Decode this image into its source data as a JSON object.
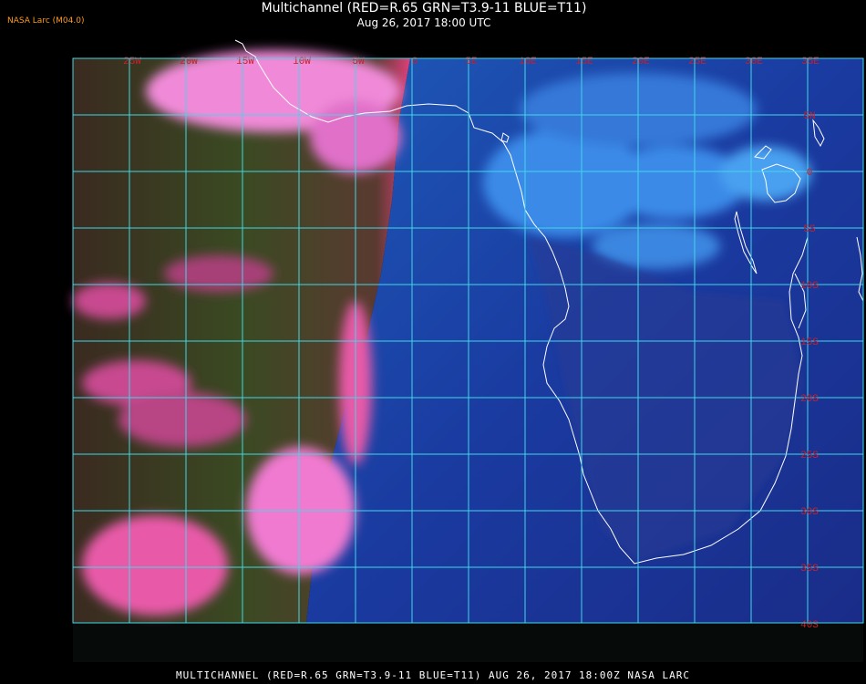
{
  "header": {
    "brand": "NASA Larc (M04.0)",
    "title": "Multichannel (RED=R.65 GRN=T3.9-11 BLUE=T11)",
    "subtitle": "Aug 26, 2017 18:00 UTC"
  },
  "footer": {
    "caption": "MULTICHANNEL (RED=R.65 GRN=T3.9-11 BLUE=T11) AUG 26, 2017 18:00Z   NASA LARC"
  },
  "map": {
    "longitude_labels": [
      "25W",
      "20W",
      "15W",
      "10W",
      "5W",
      "0",
      "5E",
      "10E",
      "15E",
      "20E",
      "25E",
      "30E",
      "35E"
    ],
    "latitude_labels": [
      "5N",
      "0",
      "5S",
      "10S",
      "15S",
      "20S",
      "25S",
      "30S",
      "35S",
      "40S"
    ],
    "colors": {
      "grid": "#3fd8e8",
      "coastline": "#ffffff",
      "label": "#c8202a",
      "ocean_west": "#2c3a1c",
      "ocean_east": "#1a3da8",
      "cloud_pink": "#e85aa8",
      "cloud_blue": "#2f7ae0"
    }
  }
}
